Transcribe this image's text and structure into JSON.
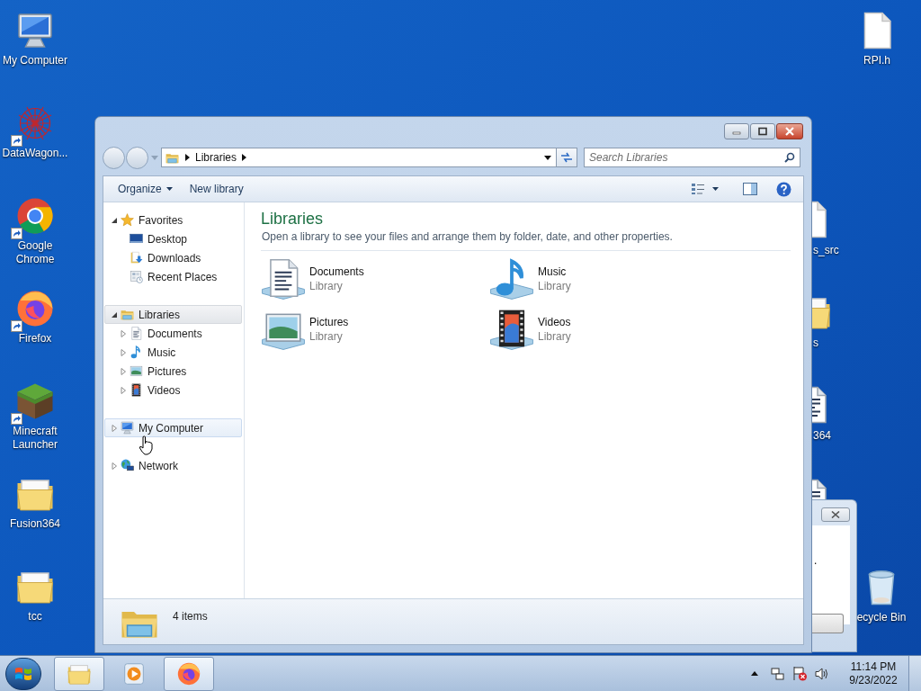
{
  "desktop": {
    "left_icons": [
      {
        "label": "My Computer",
        "kind": "computer",
        "shortcut": false
      },
      {
        "label": "DataWagon...",
        "kind": "datawagon",
        "shortcut": true
      },
      {
        "label": "Google Chrome",
        "kind": "chrome",
        "shortcut": true
      },
      {
        "label": "Firefox",
        "kind": "firefox",
        "shortcut": true
      },
      {
        "label": "Minecraft Launcher",
        "kind": "minecraft",
        "shortcut": true
      },
      {
        "label": "Fusion364",
        "kind": "folder",
        "shortcut": false
      },
      {
        "label": "tcc",
        "kind": "folder",
        "shortcut": false
      }
    ],
    "right_icons": [
      {
        "label": "RPI.h",
        "kind": "file"
      }
    ],
    "covered_icons": [
      {
        "label": "s_src",
        "kind": "file"
      },
      {
        "label": "s",
        "kind": "folder"
      },
      {
        "label": "364",
        "kind": "document"
      },
      {
        "kind": "document"
      }
    ],
    "recycle_bin": {
      "label": "ecycle Bin",
      "kind": "recycle"
    },
    "background_dialog": {
      "text": "."
    }
  },
  "explorer": {
    "address": {
      "segments": [
        "Libraries"
      ]
    },
    "search": {
      "placeholder": "Search Libraries"
    },
    "toolbar": [
      {
        "label": "Organize",
        "menu": true
      },
      {
        "label": "New library",
        "menu": false
      }
    ],
    "nav": [
      {
        "label": "Favorites",
        "kind": "star",
        "expanded": true,
        "selected": false,
        "hovered": false,
        "children": [
          {
            "label": "Desktop",
            "kind": "desktop",
            "selected": false,
            "hovered": false
          },
          {
            "label": "Downloads",
            "kind": "downloads",
            "selected": false,
            "hovered": false
          },
          {
            "label": "Recent Places",
            "kind": "recent",
            "selected": false,
            "hovered": false
          }
        ]
      },
      {
        "label": "Libraries",
        "kind": "library",
        "expanded": true,
        "selected": true,
        "hovered": false,
        "children": [
          {
            "label": "Documents",
            "kind": "document",
            "expanded": false,
            "selected": false,
            "hovered": false
          },
          {
            "label": "Music",
            "kind": "music",
            "expanded": false,
            "selected": false,
            "hovered": false
          },
          {
            "label": "Pictures",
            "kind": "pictures",
            "expanded": false,
            "selected": false,
            "hovered": false
          },
          {
            "label": "Videos",
            "kind": "videos",
            "expanded": false,
            "selected": false,
            "hovered": false
          }
        ]
      },
      {
        "label": "My Computer",
        "kind": "computer",
        "expanded": false,
        "selected": false,
        "hovered": true
      },
      {
        "label": "Network",
        "kind": "network",
        "expanded": false,
        "selected": false,
        "hovered": false
      }
    ],
    "content": {
      "title": "Libraries",
      "description": "Open a library to see your files and arrange them by folder, date, and other properties.",
      "items": [
        {
          "name": "Documents",
          "subtitle": "Library",
          "kind": "document"
        },
        {
          "name": "Music",
          "subtitle": "Library",
          "kind": "music"
        },
        {
          "name": "Pictures",
          "subtitle": "Library",
          "kind": "pictures"
        },
        {
          "name": "Videos",
          "subtitle": "Library",
          "kind": "videos"
        }
      ]
    },
    "status": {
      "count": "4 items"
    }
  },
  "taskbar": {
    "buttons": [
      {
        "kind": "explorer",
        "open": true
      },
      {
        "kind": "media",
        "open": false
      },
      {
        "kind": "firefox",
        "open": true
      }
    ],
    "time": "11:14 PM",
    "date": "9/23/2022"
  }
}
